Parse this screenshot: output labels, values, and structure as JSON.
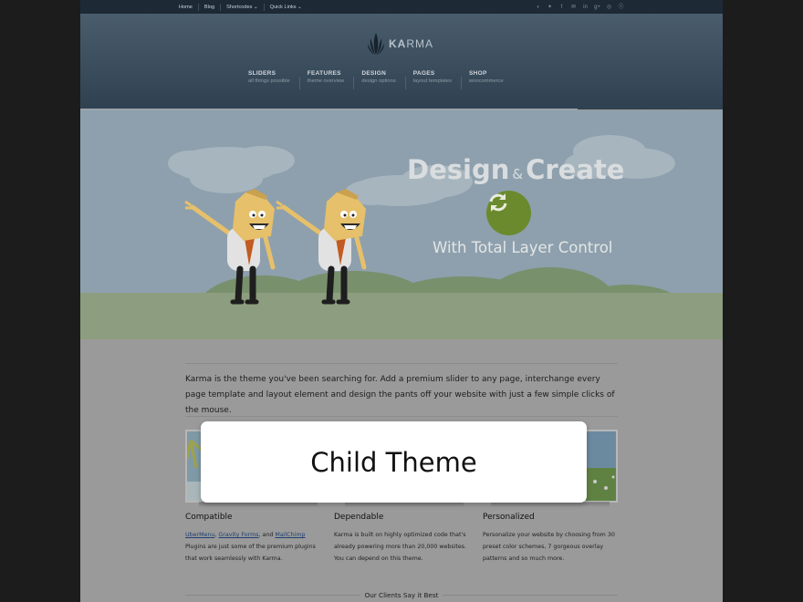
{
  "topbar": {
    "links": [
      "Home",
      "Blog",
      "Shortcodes ⌄",
      "Quick Links ⌄"
    ],
    "social_icons": [
      "rss-icon",
      "twitter-icon",
      "facebook-icon",
      "mail-icon",
      "linkedin-icon",
      "google-plus-icon",
      "dribbble-icon",
      "skype-icon"
    ]
  },
  "header": {
    "logo_bold": "KA",
    "logo_rest": "RMA",
    "nav": [
      {
        "title": "SLIDERS",
        "subtitle": "all things possible"
      },
      {
        "title": "FEATURES",
        "subtitle": "theme overview"
      },
      {
        "title": "DESIGN",
        "subtitle": "design options"
      },
      {
        "title": "PAGES",
        "subtitle": "layout templates"
      },
      {
        "title": "SHOP",
        "subtitle": "woocommerce"
      }
    ]
  },
  "hero": {
    "title_left": "Design",
    "amp": "&",
    "title_right": "Create",
    "subtitle": "With Total Layer Control",
    "button_icon": "refresh-icon",
    "button_color": "#6b8a2e"
  },
  "intro": "Karma is the theme you've been searching for. Add a premium slider to any page, interchange every page template and layout element and design the pants off your website with just a few simple clicks of the mouse.",
  "features": [
    {
      "title": "Compatible",
      "link1": "UberMenu",
      "sep1": ", ",
      "link2": "Gravity Forms",
      "sep2": ", and ",
      "link3": "MailChimp",
      "text": "Plugins are just some of the premium plugins that work seamlessly with Karma."
    },
    {
      "title": "Dependable",
      "text": "Karma is built on highly optimized code that's already powering more than 20,000 websites. You can depend on this theme."
    },
    {
      "title": "Personalized",
      "text": "Personalize your website by choosing from 30 preset color schemes, 7 gorgeous overlay patterns and so much more."
    }
  ],
  "clients_heading": "Our Clients Say it Best",
  "modal": {
    "label": "Child Theme"
  }
}
